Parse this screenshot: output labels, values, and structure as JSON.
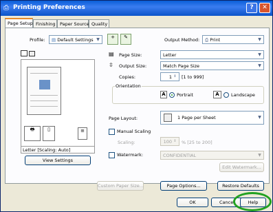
{
  "window": {
    "title": "Printing Preferences",
    "help_glyph": "?",
    "close_glyph": "✕"
  },
  "tabs": [
    {
      "label": "Page Setup"
    },
    {
      "label": "Finishing"
    },
    {
      "label": "Paper Source"
    },
    {
      "label": "Quality"
    }
  ],
  "profile": {
    "label": "Profile:",
    "value": "Default Settings"
  },
  "output_method": {
    "label": "Output Method:",
    "value": "Print"
  },
  "preview": {
    "caption": "Letter [Scaling: Auto]",
    "view_settings_label": "View Settings"
  },
  "page_size": {
    "label": "Page Size:",
    "value": "Letter"
  },
  "output_size": {
    "label": "Output Size:",
    "value": "Match Page Size"
  },
  "copies": {
    "label": "Copies:",
    "value": "1",
    "range": "[1 to 999]"
  },
  "orientation": {
    "label": "Orientation",
    "portrait": "Portrait",
    "landscape": "Landscape",
    "glyph": "A"
  },
  "page_layout": {
    "label": "Page Layout:",
    "value": "1 Page per Sheet"
  },
  "manual_scaling": {
    "label": "Manual Scaling"
  },
  "scaling": {
    "label": "Scaling:",
    "value": "100",
    "range": "% [25 to 200]"
  },
  "watermark": {
    "label": "Watermark:",
    "value": "CONFIDENTIAL",
    "edit_label": "Edit Watermark..."
  },
  "bottom_buttons": {
    "custom_paper": "Custom Paper Size...",
    "page_options": "Page Options...",
    "restore": "Restore Defaults"
  },
  "dialog_buttons": {
    "ok": "OK",
    "cancel": "Cancel",
    "help": "Help"
  },
  "colors": {
    "titlebar": "#0a5fd8",
    "highlight_ring": "#21a121",
    "tab_accent": "#e68b2c"
  }
}
